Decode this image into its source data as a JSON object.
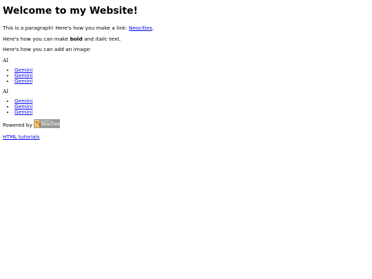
{
  "header": {
    "title": "Welcome to my Website!"
  },
  "intro": {
    "prefix": "This is a paragraph! Here's how you make a link: ",
    "link": "Neocities",
    "suffix": "."
  },
  "formatting": {
    "prefix": "Here's how you can make ",
    "bold": "bold",
    "middle": " and ",
    "italic": "italic",
    "suffix": " text."
  },
  "image_text": "Here's how you can add an image:",
  "lists": [
    {
      "label": "AI",
      "items": [
        "Gemini",
        "Gemini",
        "Gemini"
      ]
    },
    {
      "label": "AI",
      "items": [
        "Gemini",
        "Gemini",
        "Gemini"
      ]
    }
  ],
  "footer": {
    "powered_by": "Powered by",
    "badge_small": "hosted by",
    "badge_text": "Neocities",
    "tutorials_link": "HTML tutorials"
  },
  "colors": {
    "link": "#0000ee",
    "badge_bg": "#9a9a9a"
  },
  "icons": {
    "badge": "neocities-cat-icon"
  }
}
